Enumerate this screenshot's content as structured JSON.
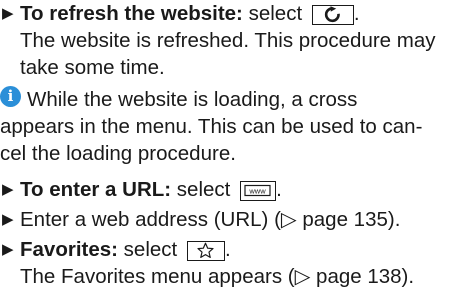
{
  "items": {
    "refresh": {
      "bold": "To refresh the website:",
      "text": " select ",
      "icon": "refresh-icon",
      "after": ".",
      "line2": "The website is refreshed. This procedure may",
      "line3": "take some time."
    },
    "note": {
      "icon": "info-icon",
      "glyph": "i",
      "line1": " While the website is loading, a cross",
      "line2": "appears in the menu. This can be used to can-",
      "line3": "cel the loading procedure."
    },
    "url": {
      "bold": "To enter a URL:",
      "text": " select ",
      "icon": "www-icon",
      "icon_text": "www",
      "after": "."
    },
    "address": {
      "text": "Enter a web address (URL) (▷ page 135)."
    },
    "favorites": {
      "bold": "Favorites:",
      "text": " select ",
      "icon": "star-icon",
      "after": ".",
      "line2": "The Favorites menu appears (▷ page 138)."
    }
  },
  "bullet_glyph": "▶",
  "info_color": "#2b8fd8"
}
